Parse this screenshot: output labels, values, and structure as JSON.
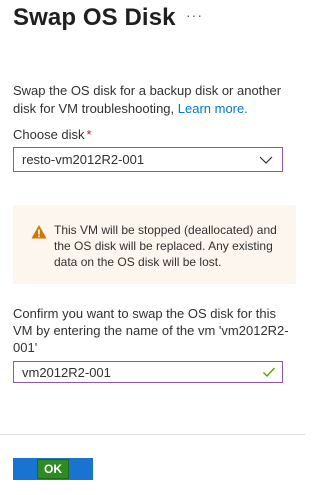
{
  "header": {
    "title": "Swap OS Disk",
    "more_label": "···"
  },
  "description": {
    "text": "Swap the OS disk for a backup disk or another disk for VM troubleshooting, ",
    "link": "Learn more."
  },
  "choose_disk": {
    "label": "Choose disk",
    "required_marker": "*",
    "selected_value": "resto-vm2012R2-001"
  },
  "warning": {
    "text": "This VM will be stopped (deallocated) and the OS disk will be replaced. Any existing data on the OS disk will be lost.",
    "icon": "warning-icon",
    "color": "#d47500"
  },
  "confirm": {
    "label": "Confirm you want to swap the OS disk for this VM by entering the name of the vm 'vm2012R2-001'",
    "input_value": "vm2012R2-001",
    "valid_icon": "check-icon",
    "valid_color": "#57a300"
  },
  "footer": {
    "ok_label": "OK",
    "primary_color": "#1874d0"
  }
}
